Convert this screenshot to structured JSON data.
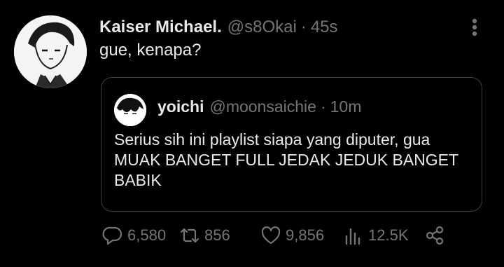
{
  "author": {
    "display_name": "Kaiser Michael.",
    "handle": "@s8Okai",
    "separator": "·",
    "time": "45s"
  },
  "tweet": {
    "text": "gue, kenapa?"
  },
  "quoted": {
    "display_name": "yoichi",
    "handle": "@moonsaichie",
    "separator": "·",
    "time": "10m",
    "text_lines": [
      "Serius sih ini playlist siapa yang diputer, gua",
      "MUAK BANGET FULL JEDAK JEDUK BANGET",
      "BABIK"
    ]
  },
  "actions": {
    "replies": "6,580",
    "retweets": "856",
    "likes": "9,856",
    "views": "12.5K"
  },
  "icons": {
    "more": "more-vertical-icon",
    "reply": "reply-icon",
    "retweet": "retweet-icon",
    "like": "heart-icon",
    "views": "views-icon",
    "share": "share-icon"
  },
  "colors": {
    "background": "#000000",
    "primary_text": "#e7e9ea",
    "secondary_text": "#71767b",
    "border": "#3e4144"
  }
}
